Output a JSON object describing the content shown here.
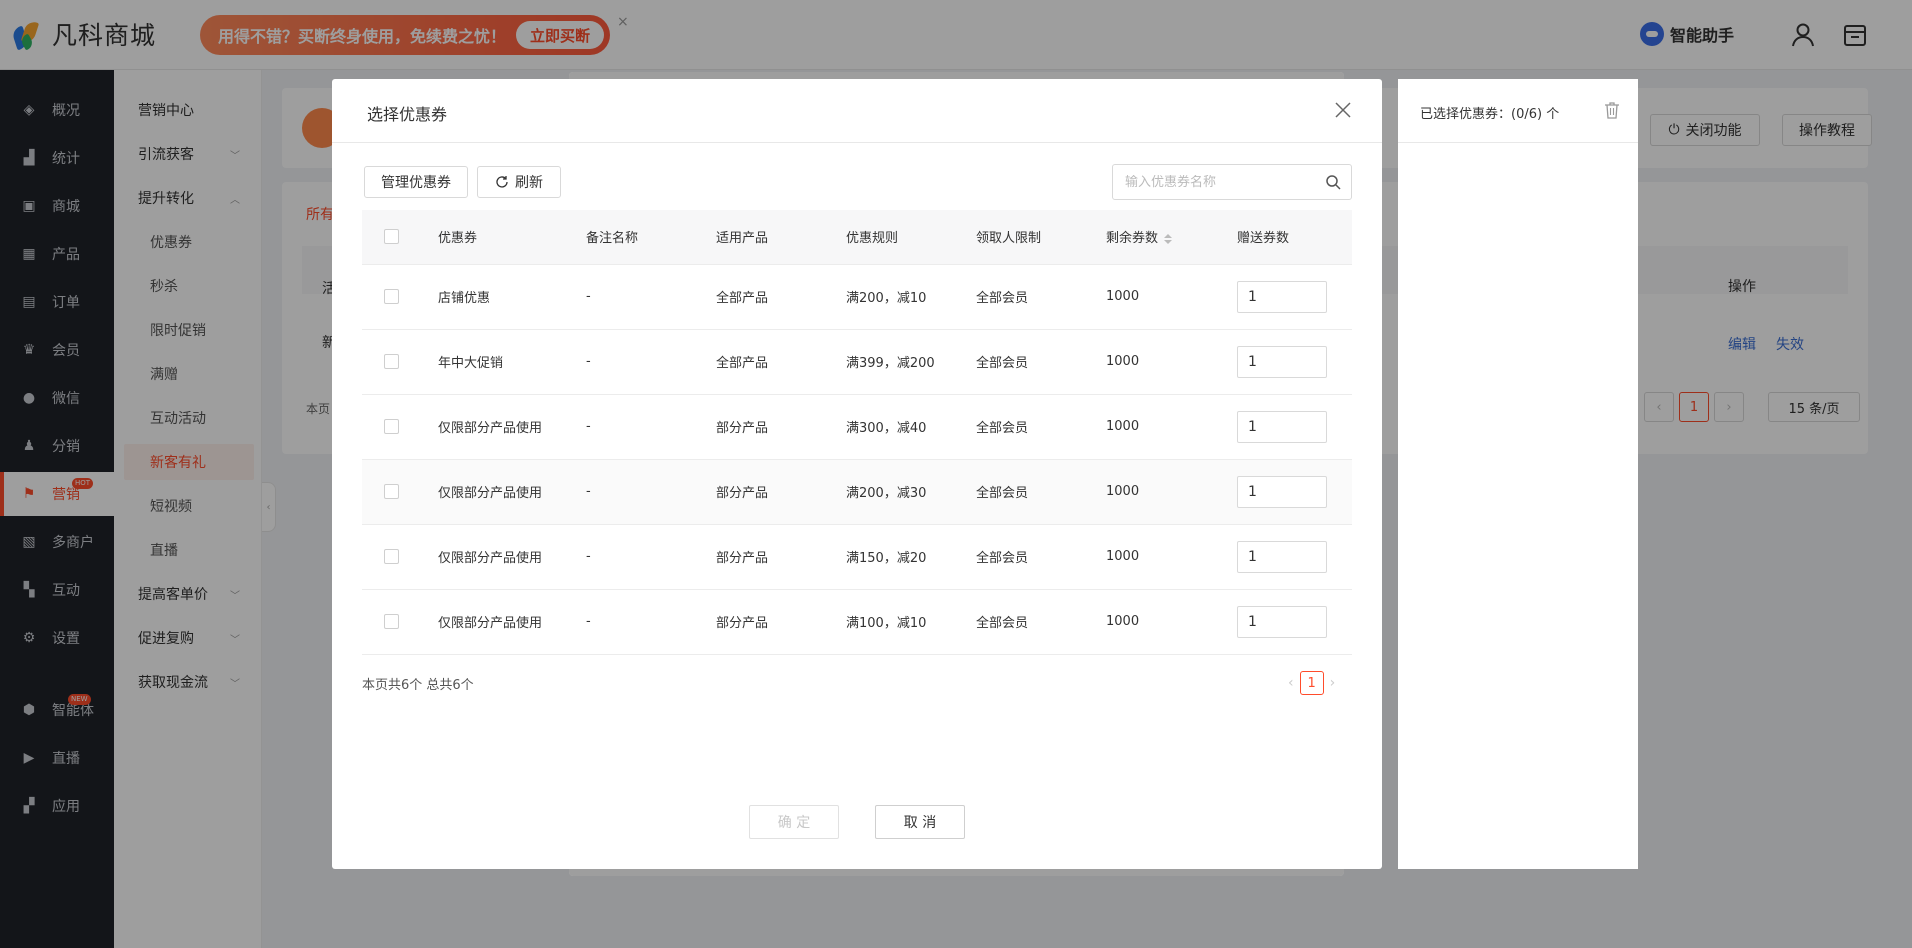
{
  "app": {
    "logo_text": "凡科商城",
    "promo_text": "用得不错？买断终身使用，免续费之忧！",
    "promo_button": "立即买断",
    "promo_close": "×",
    "assistant_label": "智能助手"
  },
  "sidebar": {
    "items": [
      {
        "label": "概况",
        "icon": "layers-icon"
      },
      {
        "label": "统计",
        "icon": "chart-icon"
      },
      {
        "label": "商城",
        "icon": "store-icon"
      },
      {
        "label": "产品",
        "icon": "grid-icon"
      },
      {
        "label": "订单",
        "icon": "order-icon"
      },
      {
        "label": "会员",
        "icon": "crown-icon"
      },
      {
        "label": "微信",
        "icon": "wechat-icon"
      },
      {
        "label": "分销",
        "icon": "users-icon"
      },
      {
        "label": "营销",
        "icon": "flag-icon",
        "badge": "HOT"
      },
      {
        "label": "多商户",
        "icon": "merchant-icon"
      },
      {
        "label": "互动",
        "icon": "interact-icon"
      },
      {
        "label": "设置",
        "icon": "gear-icon"
      },
      {
        "label": "智能体",
        "icon": "agent-icon",
        "badge": "NEW"
      },
      {
        "label": "直播",
        "icon": "live-icon"
      },
      {
        "label": "应用",
        "icon": "apps-icon"
      }
    ]
  },
  "submenu": {
    "items": [
      {
        "label": "营销中心"
      },
      {
        "label": "引流获客"
      },
      {
        "label": "提升转化"
      },
      {
        "label": "优惠券"
      },
      {
        "label": "秒杀"
      },
      {
        "label": "限时促销"
      },
      {
        "label": "满赠"
      },
      {
        "label": "互动活动"
      },
      {
        "label": "新客有礼"
      },
      {
        "label": "短视频"
      },
      {
        "label": "直播"
      },
      {
        "label": "提高客单价"
      },
      {
        "label": "促进复购"
      },
      {
        "label": "获取现金流"
      }
    ]
  },
  "background": {
    "close_feature": "关闭功能",
    "tutorial": "操作教程",
    "tab_partial": "所有",
    "col_partial": "活",
    "row_partial": "新",
    "summary_partial": "本页",
    "op_header": "操作",
    "edit": "编辑",
    "invalidate": "失效",
    "page": "1",
    "page_size": "15 条/页"
  },
  "dialog": {
    "title": "选择优惠券",
    "manage_button": "管理优惠券",
    "refresh_button": "刷新",
    "search_placeholder": "输入优惠券名称",
    "columns": [
      "优惠券",
      "备注名称",
      "适用产品",
      "优惠规则",
      "领取人限制",
      "剩余券数",
      "赠送券数"
    ],
    "rows": [
      {
        "name": "店铺优惠",
        "remark": "-",
        "product": "全部产品",
        "rule": "满200，减10",
        "limit": "全部会员",
        "remaining": "1000",
        "give": "1"
      },
      {
        "name": "年中大促销",
        "remark": "-",
        "product": "全部产品",
        "rule": "满399，减200",
        "limit": "全部会员",
        "remaining": "1000",
        "give": "1"
      },
      {
        "name": "仅限部分产品使用",
        "remark": "-",
        "product": "部分产品",
        "rule": "满300，减40",
        "limit": "全部会员",
        "remaining": "1000",
        "give": "1"
      },
      {
        "name": "仅限部分产品使用",
        "remark": "-",
        "product": "部分产品",
        "rule": "满200，减30",
        "limit": "全部会员",
        "remaining": "1000",
        "give": "1"
      },
      {
        "name": "仅限部分产品使用",
        "remark": "-",
        "product": "部分产品",
        "rule": "满150，减20",
        "limit": "全部会员",
        "remaining": "1000",
        "give": "1"
      },
      {
        "name": "仅限部分产品使用",
        "remark": "-",
        "product": "部分产品",
        "rule": "满100，减10",
        "limit": "全部会员",
        "remaining": "1000",
        "give": "1"
      }
    ],
    "summary": "本页共6个 总共6个",
    "current_page": "1",
    "confirm_button": "确 定",
    "cancel_button": "取 消"
  },
  "selected_panel": {
    "title": "已选择优惠券：(0/6) 个"
  },
  "colors": {
    "accent": "#ff4c2b",
    "sidebar_bg": "#1f2229",
    "link": "#3b6fd3"
  }
}
